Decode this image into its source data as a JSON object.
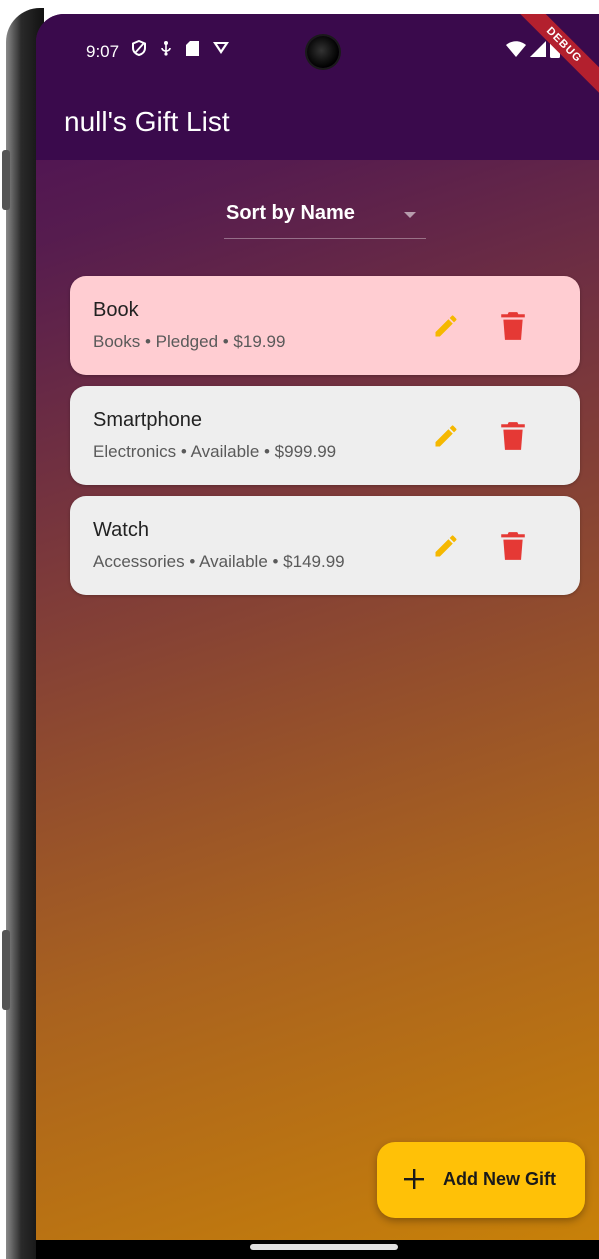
{
  "status_bar": {
    "time": "9:07",
    "left_icons": [
      "shield-icon",
      "usb-icon",
      "sd-card-icon",
      "vpn-icon"
    ],
    "right_icons": [
      "wifi-icon",
      "signal-icon",
      "battery-icon"
    ]
  },
  "debug_banner": "DEBUG",
  "app_bar": {
    "title": "null's Gift List"
  },
  "sort": {
    "selected": "Sort by Name"
  },
  "gifts": [
    {
      "name": "Book",
      "details": "Books • Pledged • $19.99",
      "background": "#ffcdd2"
    },
    {
      "name": "Smartphone",
      "details": "Electronics • Available • $999.99",
      "background": "#eeeeee"
    },
    {
      "name": "Watch",
      "details": "Accessories • Available • $149.99",
      "background": "#eeeeee"
    }
  ],
  "fab": {
    "label": "Add New Gift",
    "icon": "plus-icon"
  },
  "colors": {
    "app_bar": "#3a0a4c",
    "edit_icon": "#f5b800",
    "delete_icon": "#e53935",
    "fab": "#ffc107",
    "pledged_card": "#ffcdd2",
    "available_card": "#eeeeee"
  }
}
